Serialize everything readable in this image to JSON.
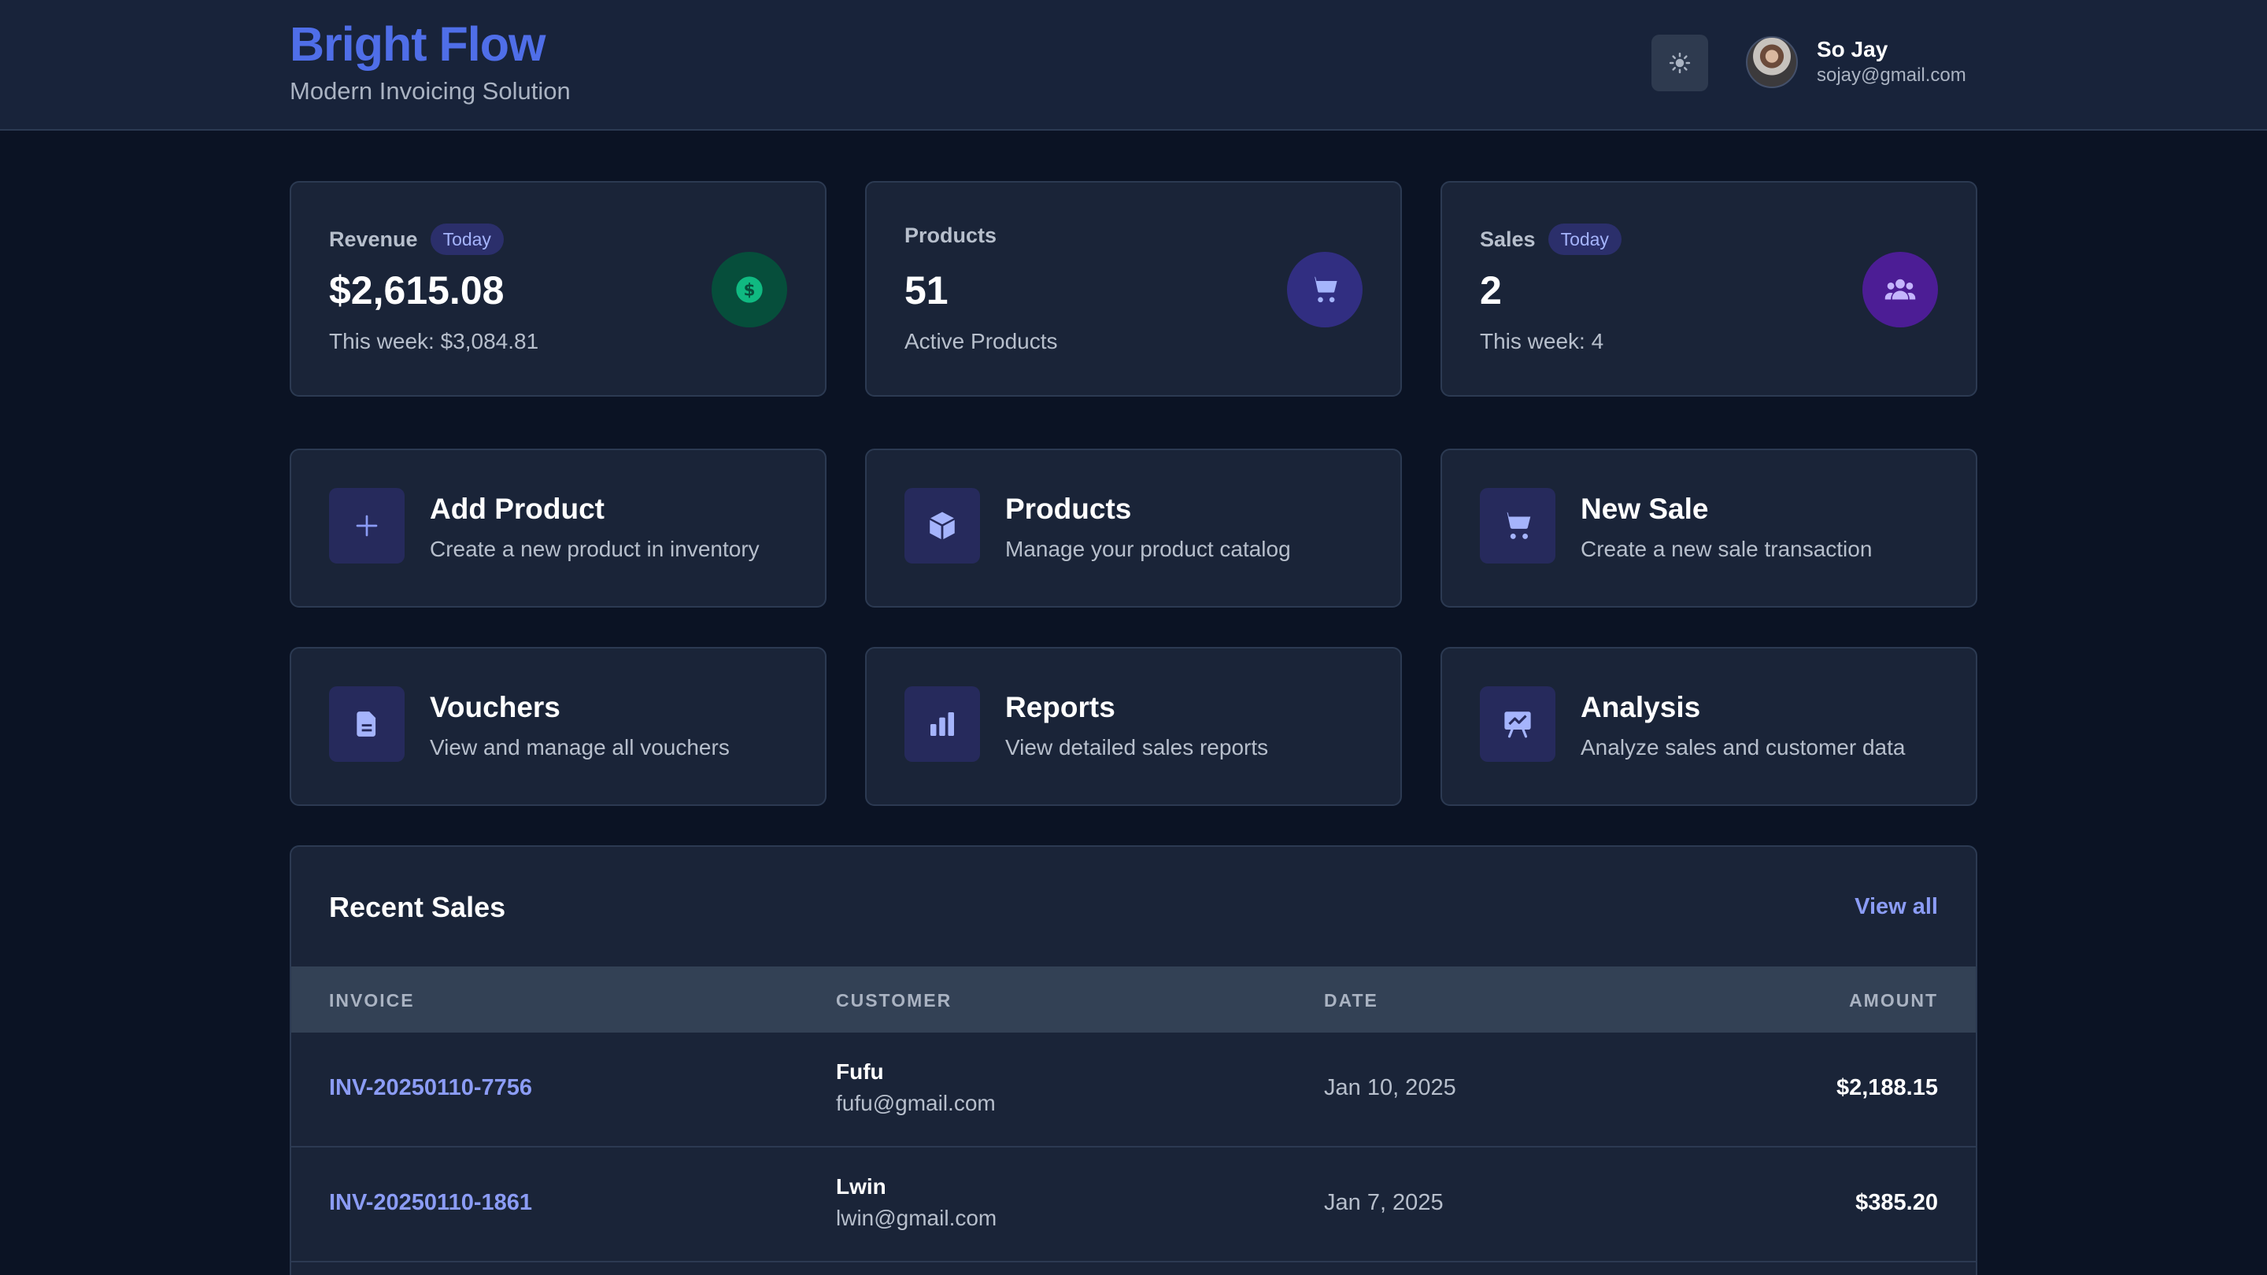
{
  "header": {
    "brand_title": "Bright Flow",
    "brand_subtitle": "Modern Invoicing Solution",
    "theme_toggle_icon": "sun-icon",
    "user": {
      "name": "So Jay",
      "email": "sojay@gmail.com"
    }
  },
  "stats": [
    {
      "label": "Revenue",
      "badge": "Today",
      "value": "$2,615.08",
      "sub": "This week: $3,084.81",
      "icon": "dollar-icon",
      "icon_color": "#10b981",
      "icon_bg": "#064e3b"
    },
    {
      "label": "Products",
      "value": "51",
      "sub": "Active Products",
      "icon": "cart-icon",
      "icon_color": "#a5b4fc",
      "icon_bg": "#312e81"
    },
    {
      "label": "Sales",
      "badge": "Today",
      "value": "2",
      "sub": "This week: 4",
      "icon": "users-icon",
      "icon_color": "#c4b5fd",
      "icon_bg": "#4c1d95"
    }
  ],
  "actions": [
    {
      "title": "Add Product",
      "desc": "Create a new product in inventory",
      "icon": "plus-icon"
    },
    {
      "title": "Products",
      "desc": "Manage your product catalog",
      "icon": "cube-icon"
    },
    {
      "title": "New Sale",
      "desc": "Create a new sale transaction",
      "icon": "cart-icon"
    },
    {
      "title": "Vouchers",
      "desc": "View and manage all vouchers",
      "icon": "document-icon"
    },
    {
      "title": "Reports",
      "desc": "View detailed sales reports",
      "icon": "bar-chart-icon"
    },
    {
      "title": "Analysis",
      "desc": "Analyze sales and customer data",
      "icon": "presentation-chart-icon"
    }
  ],
  "recent_sales": {
    "title": "Recent Sales",
    "view_all": "View all",
    "columns": [
      "INVOICE",
      "CUSTOMER",
      "DATE",
      "AMOUNT"
    ],
    "rows": [
      {
        "invoice": "INV-20250110-7756",
        "customer_name": "Fufu",
        "customer_email": "fufu@gmail.com",
        "date": "Jan 10, 2025",
        "amount": "$2,188.15"
      },
      {
        "invoice": "INV-20250110-1861",
        "customer_name": "Lwin",
        "customer_email": "lwin@gmail.com",
        "date": "Jan 7, 2025",
        "amount": "$385.20"
      }
    ]
  },
  "colors": {
    "accent": "#4f6ee8",
    "link": "#8b9cf5",
    "background": "#0b1324",
    "surface": "#1a2438"
  }
}
